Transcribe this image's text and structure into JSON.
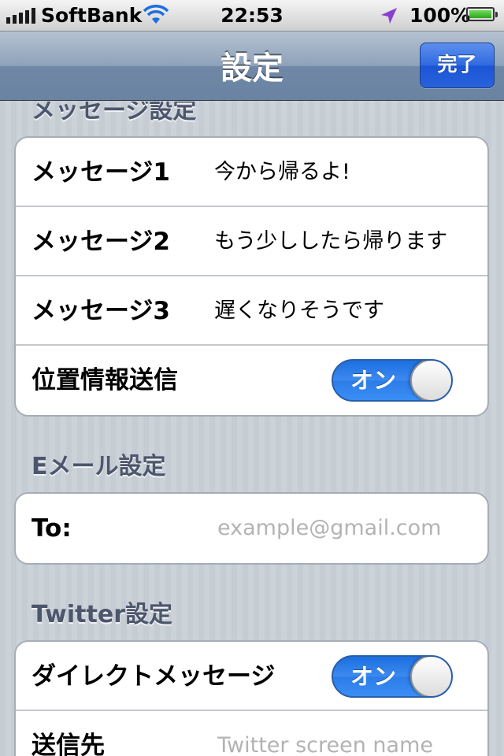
{
  "status_bar": {
    "carrier": "SoftBank",
    "time": "22:53",
    "battery_percent": "100%",
    "battery_level": 1.0,
    "signal_bars": 5,
    "icons": [
      "signal-bars-icon",
      "wifi-icon",
      "location-arrow-icon",
      "battery-icon"
    ]
  },
  "nav": {
    "title": "設定",
    "done_label": "完了"
  },
  "sections": {
    "message": {
      "header": "メッセージ設定",
      "rows": [
        {
          "label": "メッセージ1",
          "value": "今から帰るよ!"
        },
        {
          "label": "メッセージ2",
          "value": "もう少ししたら帰ります"
        },
        {
          "label": "メッセージ3",
          "value": "遅くなりそうです"
        }
      ],
      "location": {
        "label": "位置情報送信",
        "switch_label": "オン",
        "on": true
      }
    },
    "email": {
      "header": "Eメール設定",
      "to_label": "To:",
      "to_placeholder": "example@gmail.com"
    },
    "twitter": {
      "header": "Twitter設定",
      "dm": {
        "label": "ダイレクトメッセージ",
        "switch_label": "オン",
        "on": true
      },
      "recipient_label": "送信先",
      "recipient_placeholder": "Twitter screen name"
    }
  },
  "colors": {
    "nav_bar": "#6a83a2",
    "done_button": "#2f6ae0",
    "switch_on": "#2d7ce8",
    "section_header": "#4c566c",
    "placeholder": "#b3b3b3"
  }
}
